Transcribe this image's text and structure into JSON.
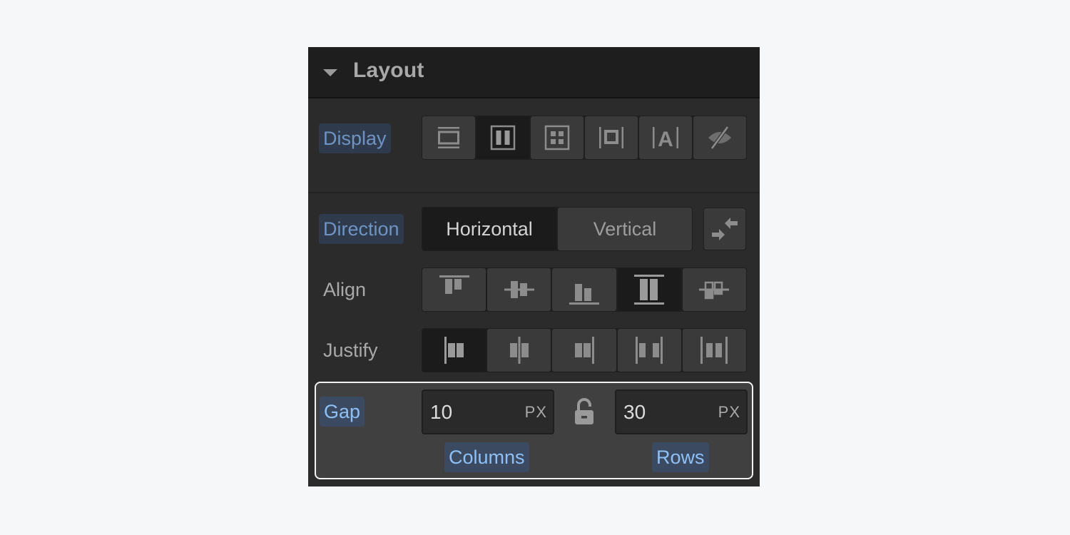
{
  "section": {
    "title": "Layout",
    "collapse_icon": "caret-down-icon"
  },
  "display": {
    "label": "Display",
    "options": [
      {
        "name": "block",
        "icon": "display-block-icon",
        "active": false
      },
      {
        "name": "flex",
        "icon": "display-flex-icon",
        "active": true
      },
      {
        "name": "grid",
        "icon": "display-grid-icon",
        "active": false
      },
      {
        "name": "inline-block",
        "icon": "display-inline-block-icon",
        "active": false
      },
      {
        "name": "inline",
        "icon": "display-inline-icon",
        "active": false
      },
      {
        "name": "none",
        "icon": "display-none-icon",
        "active": false
      }
    ]
  },
  "direction": {
    "label": "Direction",
    "options": [
      "Horizontal",
      "Vertical"
    ],
    "selected": "Horizontal",
    "reverse_icon": "reverse-direction-icon"
  },
  "align": {
    "label": "Align",
    "options": [
      {
        "name": "start",
        "icon": "align-start-icon",
        "active": false
      },
      {
        "name": "center",
        "icon": "align-center-icon",
        "active": false
      },
      {
        "name": "end",
        "icon": "align-end-icon",
        "active": false
      },
      {
        "name": "stretch",
        "icon": "align-stretch-icon",
        "active": true
      },
      {
        "name": "baseline",
        "icon": "align-baseline-icon",
        "active": false
      }
    ]
  },
  "justify": {
    "label": "Justify",
    "options": [
      {
        "name": "start",
        "icon": "justify-start-icon",
        "active": true
      },
      {
        "name": "center",
        "icon": "justify-center-icon",
        "active": false
      },
      {
        "name": "end",
        "icon": "justify-end-icon",
        "active": false
      },
      {
        "name": "space-between",
        "icon": "justify-space-between-icon",
        "active": false
      },
      {
        "name": "space-around",
        "icon": "justify-space-around-icon",
        "active": false
      }
    ]
  },
  "gap": {
    "label": "Gap",
    "columns": {
      "value": "10",
      "unit": "PX",
      "label": "Columns"
    },
    "rows": {
      "value": "30",
      "unit": "PX",
      "label": "Rows"
    },
    "lock_icon": "unlocked-icon"
  },
  "colors": {
    "accent_label_bg": "#2f3b4c",
    "accent_label_text": "#6f93c3",
    "highlight_border": "#f2f2f2"
  }
}
